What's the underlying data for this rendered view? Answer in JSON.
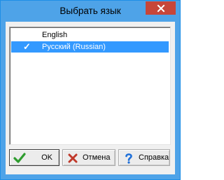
{
  "window": {
    "title": "Выбрать язык"
  },
  "language_list": {
    "items": [
      {
        "label": "English",
        "selected": false
      },
      {
        "label": "Русский (Russian)",
        "selected": true,
        "check_mark": "✓"
      }
    ]
  },
  "buttons": {
    "ok_label": "OK",
    "cancel_label": "Отмена",
    "help_label": "Справка"
  },
  "icons": {
    "ok": "green-check-icon",
    "cancel": "red-x-icon",
    "help": "blue-question-icon",
    "close": "close-icon"
  },
  "colors": {
    "titlebar": "#4ea3e8",
    "close_button": "#c7463a",
    "selection": "#3399ff",
    "ok_icon": "#2e9c2e",
    "cancel_icon": "#c0392b",
    "help_icon": "#1e6fd9"
  }
}
